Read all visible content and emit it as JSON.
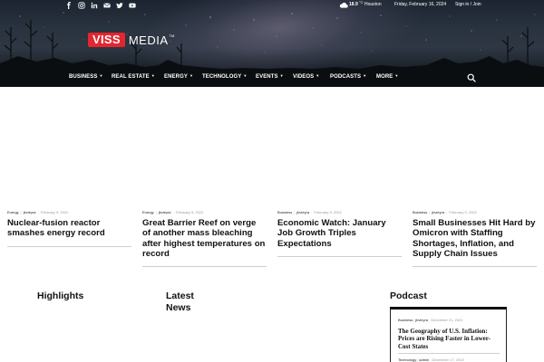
{
  "colors": {
    "brand_red": "#e3262f",
    "header_dark": "#1b222b"
  },
  "topbar": {
    "social_icons": [
      "facebook-icon",
      "instagram-icon",
      "linkedin-icon",
      "email-icon",
      "twitter-icon",
      "youtube-icon"
    ],
    "temperature": "18.9",
    "temperature_unit": "°",
    "temperature_scale": "C",
    "city": "Houston",
    "date": "Friday, February 16, 2024",
    "signin": "Sign in / Join"
  },
  "logo": {
    "box_text": "VISS",
    "text": "MEDIA",
    "tm": "TM"
  },
  "nav": {
    "items": [
      {
        "label": "BUSINESS"
      },
      {
        "label": "REAL ESTATE"
      },
      {
        "label": "ENERGY"
      },
      {
        "label": "TECHNOLOGY"
      },
      {
        "label": "EVENTS"
      },
      {
        "label": "VIDEOS"
      },
      {
        "label": "PODCASTS"
      },
      {
        "label": "MORE"
      }
    ]
  },
  "articles": [
    {
      "category": "Energy",
      "author": "jbvieyra",
      "date": "February 9, 2022",
      "title": "Nuclear-fusion reactor smashes energy record"
    },
    {
      "category": "Energy",
      "author": "jbvieyra",
      "date": "February 9, 2022",
      "title": "Great Barrier Reef on verge of another mass bleaching after highest temperatures on record"
    },
    {
      "category": "Business",
      "author": "jbvieyra",
      "date": "February 9, 2022",
      "title": "Economic Watch: January Job Growth Triples Expectations"
    },
    {
      "category": "Business",
      "author": "jbvieyra",
      "date": "February 9, 2022",
      "title": "Small Businesses Hit Hard by Omicron with Staffing Shortages, Inflation, and Supply Chain Issues"
    }
  ],
  "sections": {
    "highlights": "Highlights",
    "latest_news_line1": "Latest",
    "latest_news_line2": "News",
    "podcast": "Podcast"
  },
  "podcast_items": [
    {
      "category": "Business",
      "author": "jbvieyra",
      "date": "December 21, 2021",
      "title": "The Geography of U.S. Inflation: Prices are Rising Faster in Lower-Cost States"
    },
    {
      "category": "Technology",
      "author": "admin",
      "date": "December 17, 2019"
    }
  ]
}
